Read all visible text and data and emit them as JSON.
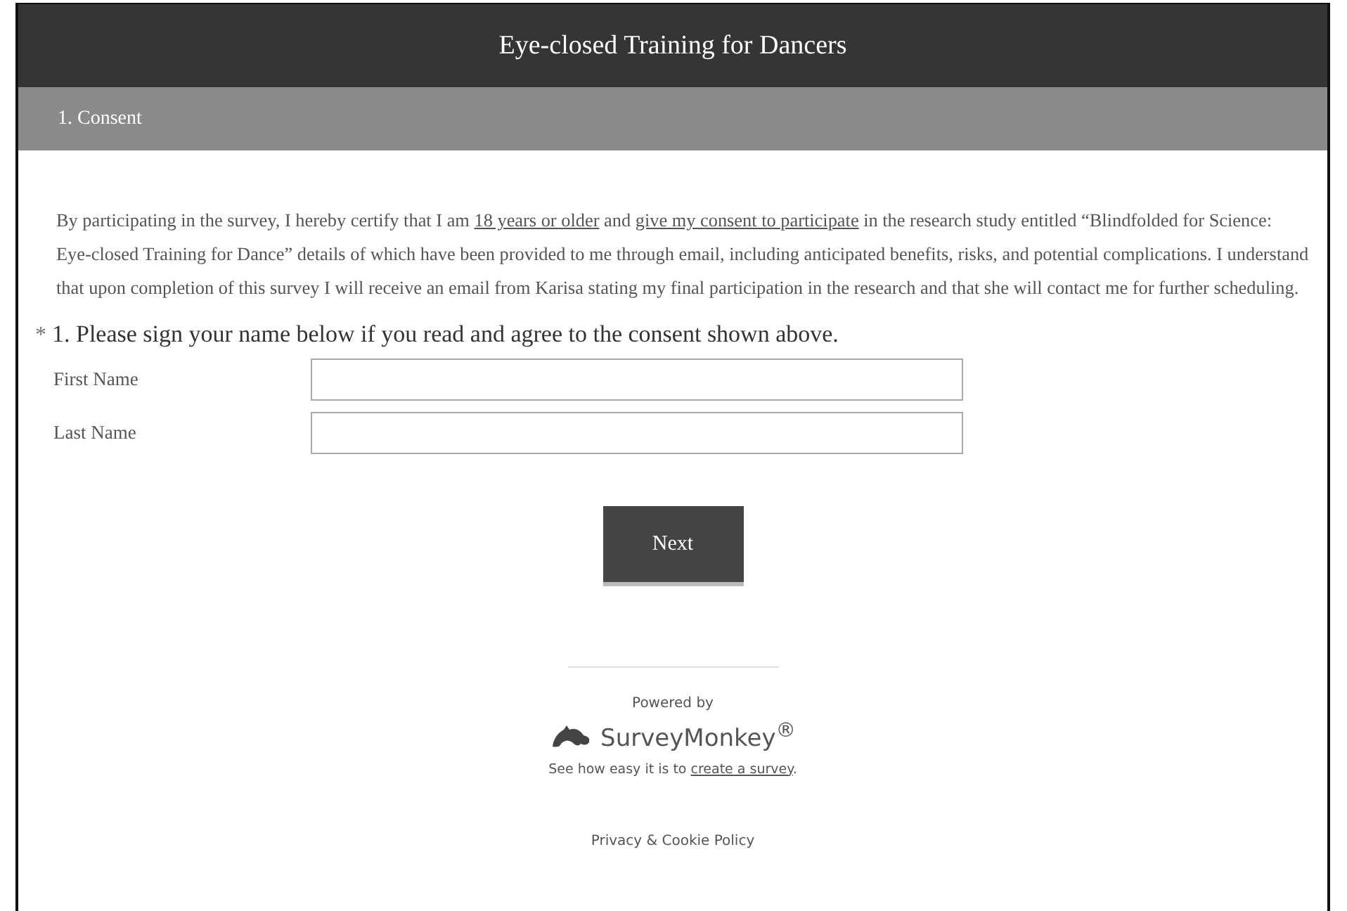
{
  "header": {
    "title": "Eye-closed Training for Dancers"
  },
  "page_bar": {
    "title": "1. Consent"
  },
  "consent_text": [
    {
      "kind": "text",
      "text": "By participating in the survey, I hereby certify that I am "
    },
    {
      "kind": "link",
      "text": "18 years or older"
    },
    {
      "kind": "text",
      "text": " and "
    },
    {
      "kind": "link",
      "text": "give my consent to participate"
    },
    {
      "kind": "text",
      "text": " in the research study entitled “Blindfolded for Science: Eye-closed Training for Dance” details of which have been provided to me through email, including anticipated benefits, risks, and potential complications. I understand that upon completion of this survey I will receive an email from Karisa stating my final participation in the research and that she will contact me for further scheduling."
    }
  ],
  "question": {
    "required_mark": "*",
    "text": "1. Please sign your name below if you read and agree to the consent shown above.",
    "fields": [
      {
        "label": "First Name"
      },
      {
        "label": "Last Name"
      }
    ]
  },
  "next_button": "Next",
  "footer": {
    "powered_by": "Powered by",
    "logo_text": "SurveyMonkey$^{®}$",
    "promo_text": "See how easy it is to ",
    "promo_link": "create a survey",
    "promo_end": ".",
    "policy_link": "Privacy & Cookie Policy"
  }
}
